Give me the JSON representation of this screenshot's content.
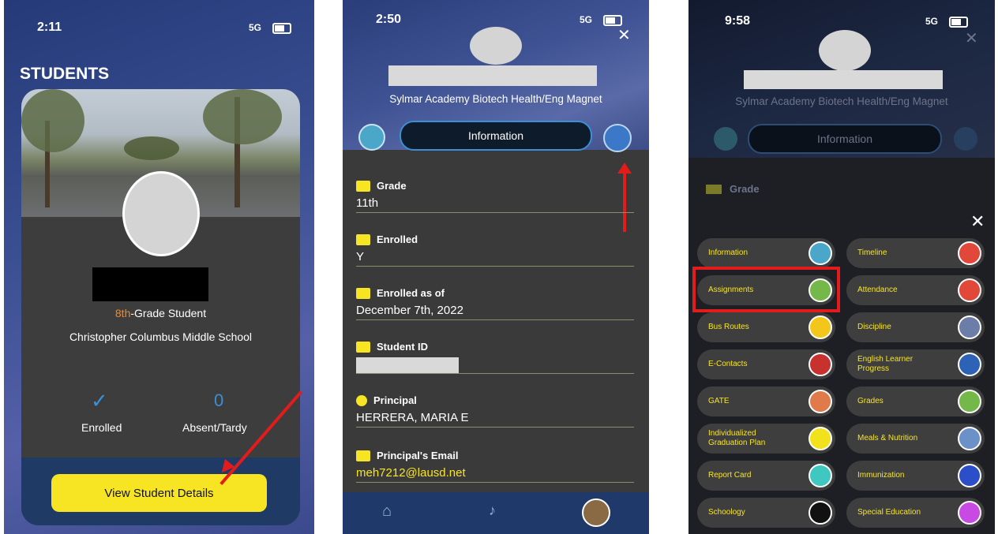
{
  "phone1": {
    "time": "2:11",
    "signal": "5G",
    "title": "STUDENTS",
    "grade_num": "8th",
    "grade_suffix": "-Grade Student",
    "school": "Christopher Columbus Middle School",
    "enrolled_check": "✓",
    "enrolled_label": "Enrolled",
    "absent_count": "0",
    "absent_label": "Absent/Tardy",
    "button": "View Student Details"
  },
  "phone2": {
    "time": "2:50",
    "signal": "5G",
    "close": "✕",
    "school": "Sylmar Academy Biotech Health/Eng Magnet",
    "tab": "Information",
    "fields": [
      {
        "label": "Grade",
        "value": "11th"
      },
      {
        "label": "Enrolled",
        "value": "Y"
      },
      {
        "label": "Enrolled as of",
        "value": "December 7th, 2022"
      },
      {
        "label": "Student ID",
        "value": ""
      },
      {
        "label": "Principal",
        "value": "HERRERA, MARIA E"
      },
      {
        "label": "Principal's Email",
        "value": "meh7212@lausd.net"
      }
    ]
  },
  "phone3": {
    "time": "9:58",
    "signal": "5G",
    "close": "✕",
    "school": "Sylmar Academy Biotech Health/Eng Magnet",
    "tab": "Information",
    "grade_label": "Grade",
    "menu_close": "✕",
    "menu": [
      {
        "label": "Information",
        "icon": "info-icon",
        "color": "#4aa7c9"
      },
      {
        "label": "Timeline",
        "icon": "timeline-icon",
        "color": "#e2483a"
      },
      {
        "label": "Assignments",
        "icon": "assignments-icon",
        "color": "#74b84a"
      },
      {
        "label": "Attendance",
        "icon": "attendance-icon",
        "color": "#e2483a"
      },
      {
        "label": "Bus Routes",
        "icon": "bus-icon",
        "color": "#f2c61b"
      },
      {
        "label": "Discipline",
        "icon": "discipline-icon",
        "color": "#6c7ea8"
      },
      {
        "label": "E-Contacts",
        "icon": "phone-icon",
        "color": "#c8322e"
      },
      {
        "label": "English Learner Progress",
        "icon": "book-icon",
        "color": "#2c63b6"
      },
      {
        "label": "GATE",
        "icon": "gate-icon",
        "color": "#e07a4a"
      },
      {
        "label": "Grades",
        "icon": "grades-icon",
        "color": "#74b84a"
      },
      {
        "label": "Individualized Graduation Plan",
        "icon": "plan-icon",
        "color": "#f2e21b"
      },
      {
        "label": "Meals & Nutrition",
        "icon": "meals-icon",
        "color": "#6c90c8"
      },
      {
        "label": "Report Card",
        "icon": "report-card-icon",
        "color": "#3ec8c0"
      },
      {
        "label": "Immunization",
        "icon": "immunization-icon",
        "color": "#2c4ec8"
      },
      {
        "label": "Schoology",
        "icon": "schoology-icon",
        "color": "#111111"
      },
      {
        "label": "Special Education",
        "icon": "special-education-icon",
        "color": "#c84ae2"
      }
    ]
  }
}
